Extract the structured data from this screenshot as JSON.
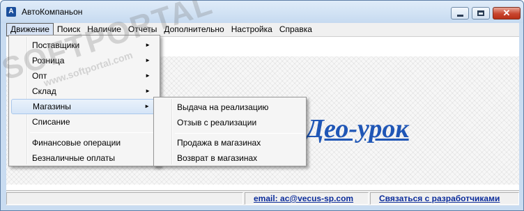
{
  "window": {
    "title": "АвтоКомпаньон",
    "app_icon": "A",
    "controls": {
      "minimize": "minimize-icon",
      "maximize": "maximize-icon",
      "close": "close-icon"
    }
  },
  "menubar": {
    "items": [
      "Движение",
      "Поиск",
      "Наличие",
      "Отчеты",
      "Дополнительно",
      "Настройка",
      "Справка"
    ],
    "active": "Движение"
  },
  "movement_menu": {
    "items": [
      {
        "label": "Поставщики",
        "has_submenu": true
      },
      {
        "label": "Розница",
        "has_submenu": true
      },
      {
        "label": "Опт",
        "has_submenu": true
      },
      {
        "label": "Склад",
        "has_submenu": true
      },
      {
        "label": "Магазины",
        "has_submenu": true,
        "highlighted": true
      },
      {
        "label": "Списание",
        "has_submenu": false
      },
      {
        "label": "Финансовые операции",
        "has_submenu": false
      },
      {
        "label": "Безналичные оплаты",
        "has_submenu": false
      }
    ],
    "submenu_arrow": "►"
  },
  "stores_submenu": {
    "items": [
      "Выдача на реализацию",
      "Отзыв с реализации",
      "Продажа в магазинах",
      "Возврат в магазинах"
    ]
  },
  "content": {
    "video_link": "Део-урок"
  },
  "statusbar": {
    "email_link": "email:  ac@vecus-sp.com",
    "contact_link": "Связаться с разработчиками"
  },
  "watermark": {
    "main": "SOFTPORTAL",
    "sub": "www.softportal.com"
  },
  "colors": {
    "link": "#1f56b6",
    "status_link": "#0b2c9a",
    "close_button": "#c8452f"
  }
}
